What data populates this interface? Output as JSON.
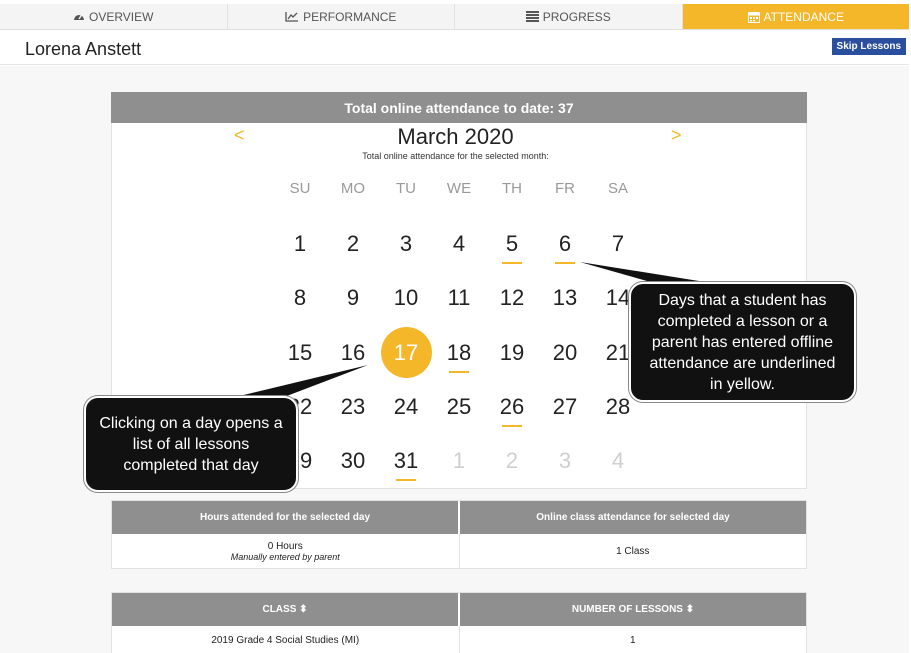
{
  "tabs": [
    {
      "label": "OVERVIEW",
      "icon": "tachometer-icon"
    },
    {
      "label": "PERFORMANCE",
      "icon": "line-chart-icon"
    },
    {
      "label": "PROGRESS",
      "icon": "list-icon"
    },
    {
      "label": "ATTENDANCE",
      "icon": "calendar-icon",
      "active": true
    }
  ],
  "header": {
    "student_name": "Lorena Anstett",
    "skip_label": "Skip Lessons"
  },
  "calendar": {
    "total_label": "Total online attendance to date: 37",
    "prev": "<",
    "next": ">",
    "month": "March 2020",
    "month_sub": "Total online attendance for the selected month:",
    "weekdays": [
      "SU",
      "MO",
      "TU",
      "WE",
      "TH",
      "FR",
      "SA"
    ],
    "weeks": [
      [
        "1",
        "2",
        "3",
        "4",
        "5",
        "6",
        "7"
      ],
      [
        "8",
        "9",
        "10",
        "11",
        "12",
        "13",
        "14"
      ],
      [
        "15",
        "16",
        "17",
        "18",
        "19",
        "20",
        "21"
      ],
      [
        "22",
        "23",
        "24",
        "25",
        "26",
        "27",
        "28"
      ],
      [
        "29",
        "30",
        "31",
        "1",
        "2",
        "3",
        "4"
      ]
    ],
    "attended_days": [
      "5",
      "6",
      "17",
      "18",
      "26",
      "31"
    ],
    "selected_day": "17"
  },
  "callouts": {
    "right": "Days that a student has completed a lesson or a parent has entered offline attendance are underlined in yellow.",
    "left": "Clicking on a day opens a list of all lessons completed that day"
  },
  "day_summary": {
    "headers": [
      "Hours attended for the selected day",
      "Online class attendance for selected day"
    ],
    "hours": "0 Hours",
    "hours_note": "Manually entered by parent",
    "classes": "1 Class"
  },
  "lessons_table": {
    "headers": [
      "CLASS ⬍",
      "NUMBER OF LESSONS ⬍"
    ],
    "rows": [
      [
        "2019 Grade 4 Social Studies (MI)",
        "1"
      ]
    ]
  },
  "colors": {
    "accent": "#f5b72a",
    "header_gray": "#8f8f8f",
    "button_blue": "#2a4f9e"
  }
}
